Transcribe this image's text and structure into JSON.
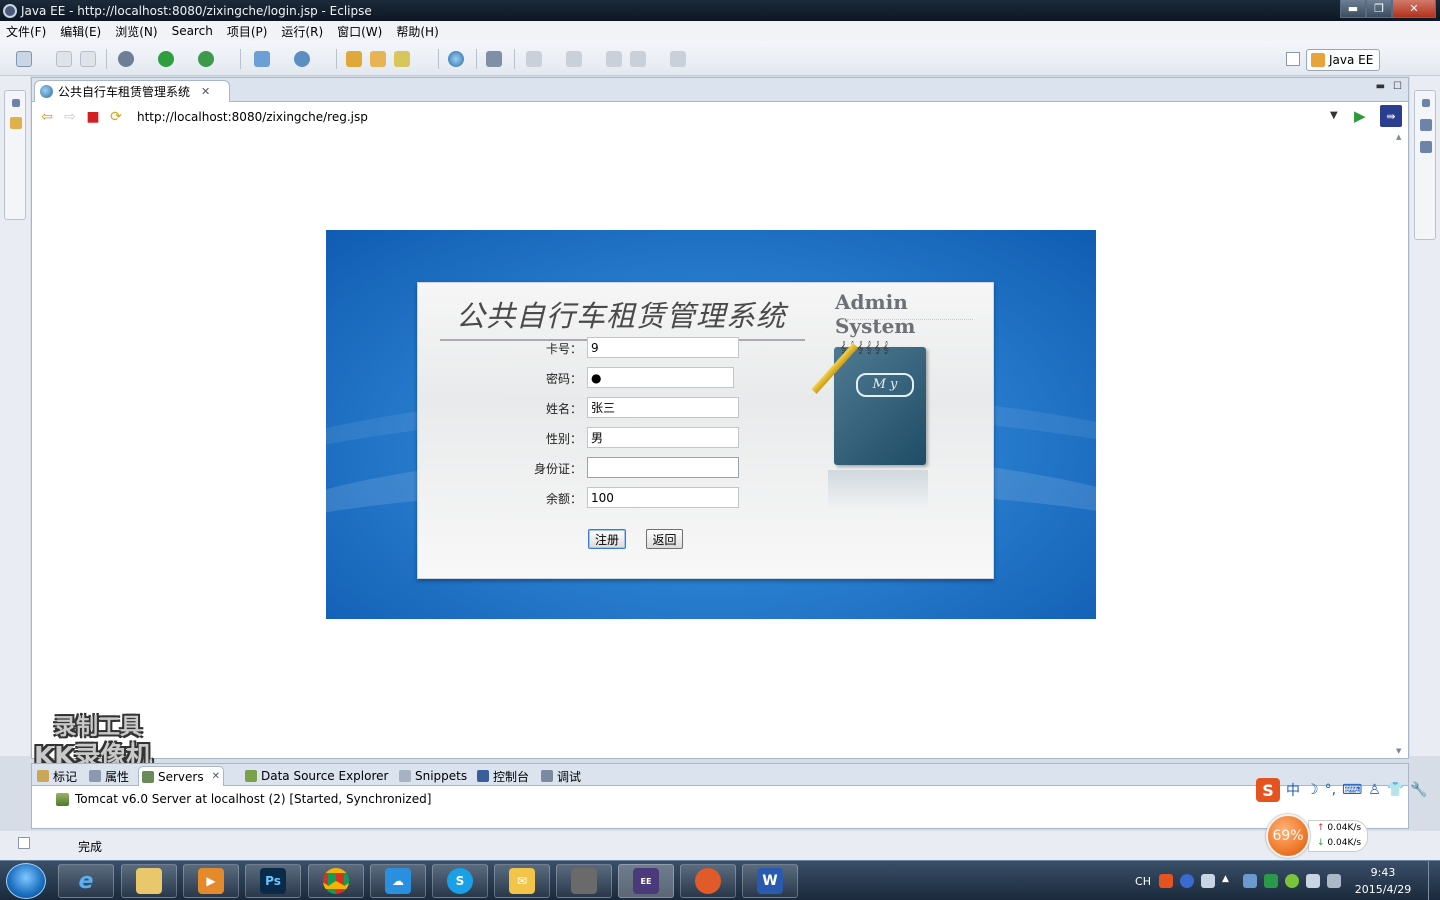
{
  "window": {
    "title": "Java EE  -  http://localhost:8080/zixingche/login.jsp  -  Eclipse",
    "controls": [
      "minimize",
      "maximize",
      "close"
    ]
  },
  "menu": [
    "文件(F)",
    "编辑(E)",
    "浏览(N)",
    "Search",
    "项目(P)",
    "运行(R)",
    "窗口(W)",
    "帮助(H)"
  ],
  "perspective": {
    "label": "Java EE"
  },
  "editor": {
    "tab_label": "公共自行车租赁管理系统",
    "url": "http://localhost:8080/zixingche/reg.jsp"
  },
  "page": {
    "title": "公共自行车租赁管理系统",
    "admin_label": "Admin System",
    "notebook_text": "M y",
    "fields": [
      {
        "label": "卡号：",
        "value": "9"
      },
      {
        "label": "密码：",
        "value": "●"
      },
      {
        "label": "姓名：",
        "value": "张三"
      },
      {
        "label": "性别：",
        "value": "男"
      },
      {
        "label": "身份证：",
        "value": ""
      },
      {
        "label": "余额：",
        "value": "100"
      }
    ],
    "register_button": "注册",
    "back_button": "返回"
  },
  "bottom_tabs": [
    {
      "label": "标记",
      "active": false
    },
    {
      "label": "属性",
      "active": false
    },
    {
      "label": "Servers",
      "active": true
    },
    {
      "label": "Data Source Explorer",
      "active": false
    },
    {
      "label": "Snippets",
      "active": false
    },
    {
      "label": "控制台",
      "active": false
    },
    {
      "label": "调试",
      "active": false
    }
  ],
  "server_entry": "Tomcat v6.0 Server at localhost (2)  [Started, Synchronized]",
  "status": "完成",
  "watermark": {
    "line1": "录制工具",
    "line2": "KK录像机"
  },
  "ime": {
    "brand": "S",
    "mode": "中",
    "items": [
      "中",
      "☽",
      "°,",
      "⌨",
      "♙",
      "👕",
      "🔧"
    ]
  },
  "net_widget": {
    "percent": "69%",
    "up": "0.04K/s",
    "down": "0.04K/s"
  },
  "taskbar": {
    "apps": [
      "ie",
      "file-explorer",
      "media-player",
      "photoshop",
      "chrome",
      "baidu-cloud",
      "skype",
      "outlook",
      "kk-recorder",
      "java-ee-ide",
      "java-app",
      "word"
    ],
    "tray_lang": "CH",
    "time": "9:43",
    "date": "2015/4/29"
  },
  "colors": {
    "page_blue": "#1a6cc4",
    "panel_gray": "#efefef",
    "accent_orange": "#f07a2a"
  }
}
